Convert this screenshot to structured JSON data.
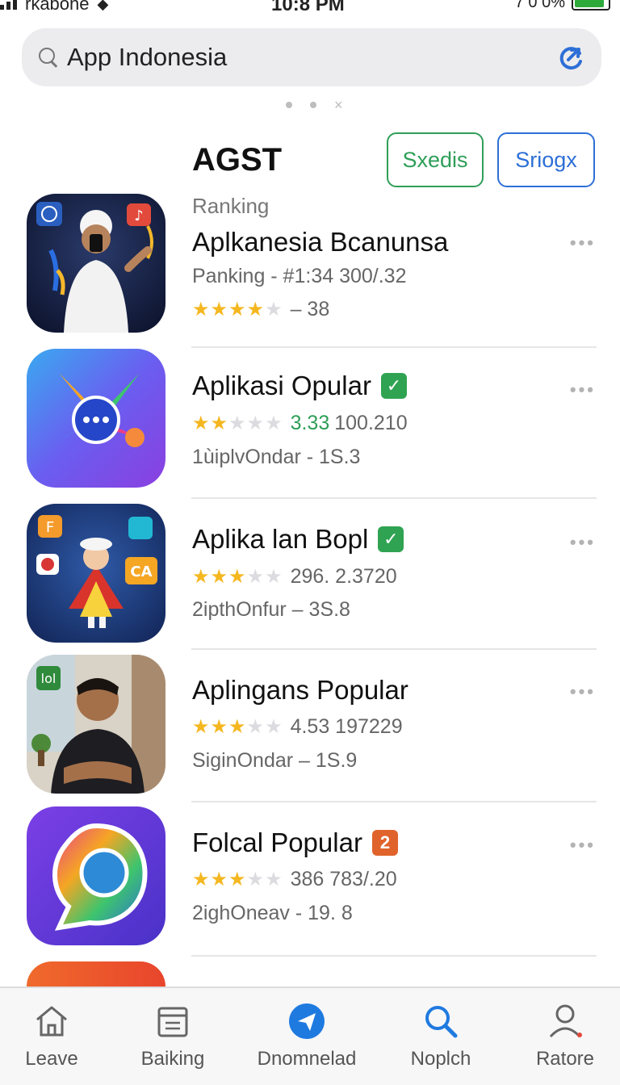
{
  "status_bar": {
    "carrier": "rkabone",
    "time": "10:8 PM",
    "battery": "7 0 0%",
    "battery_level": 0.9
  },
  "search": {
    "query": "App Indonesia",
    "icons": [
      "search-icon",
      "refresh-icon"
    ]
  },
  "header": {
    "title": "AGST",
    "button_green": "Sxedis",
    "button_blue": "Sriogx",
    "colors": {
      "green": "#2f9e58",
      "blue": "#2d6fd6"
    }
  },
  "apps": [
    {
      "label": "Ranking",
      "name": "Aplkanesia Bcanunsa",
      "line2": "Panking - #1:34 300/.32",
      "stars": 4,
      "line3": "– 38"
    },
    {
      "name": "Aplikasi Opular",
      "badge": "✓",
      "stars": 2,
      "rating": "3.33",
      "count": "100.210",
      "line3": "1ùiplvOndar - 1S.3"
    },
    {
      "name": "Aplika lan Bopl",
      "badge": "✓",
      "stars": 3,
      "count": "296. 2.3720",
      "line3": "2ipthOnfur – 3S.8"
    },
    {
      "name": "Aplingans Popular",
      "stars": 3,
      "count": "4.53 197229",
      "line3": "SiginOndar – 1S.9"
    },
    {
      "name": "Folcal Popular",
      "badge": "2",
      "stars": 3,
      "count": "386 783/.20",
      "line3": "2ighOneav - 19. 8"
    }
  ],
  "more_label": "•••",
  "tabs": [
    {
      "label": "Leave",
      "icon": "home-icon"
    },
    {
      "label": "Baiking",
      "icon": "calendar-icon"
    },
    {
      "label": "Dnomnelad",
      "icon": "send-icon"
    },
    {
      "label": "Noplch",
      "icon": "search-icon"
    },
    {
      "label": "Ratore",
      "icon": "profile-icon"
    }
  ]
}
